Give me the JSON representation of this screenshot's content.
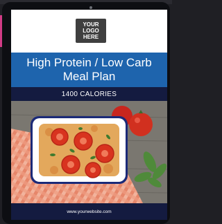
{
  "logo": {
    "text": "YOUR\nLOGO\nHERE"
  },
  "title": {
    "line1": "High Protein / Low Carb",
    "line2": "Meal Plan"
  },
  "calories": "1400 CALORIES",
  "footer": {
    "website": "www.yourwebsite.com"
  },
  "colors": {
    "title_band": "#1e64ad",
    "navy_band": "#141b40",
    "accent_pink": "#d23c86"
  }
}
